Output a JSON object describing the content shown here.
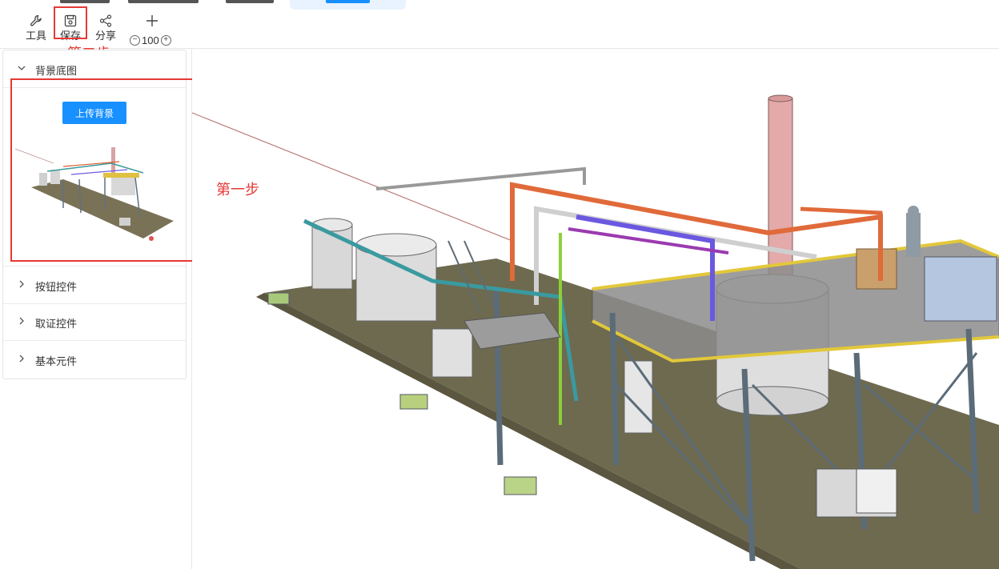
{
  "toolbar": {
    "tools_label": "工具",
    "save_label": "保存",
    "share_label": "分享",
    "zoom_value": "100"
  },
  "annotations": {
    "step1": "第一步",
    "step2": "第二步"
  },
  "panel": {
    "sections": [
      {
        "label": "背景底图",
        "expanded": true
      },
      {
        "label": "按钮控件",
        "expanded": false
      },
      {
        "label": "取证控件",
        "expanded": false
      },
      {
        "label": "基本元件",
        "expanded": false
      }
    ],
    "upload_button": "上传背景"
  },
  "colors": {
    "accent": "#1890ff",
    "annotation": "#e53935"
  }
}
